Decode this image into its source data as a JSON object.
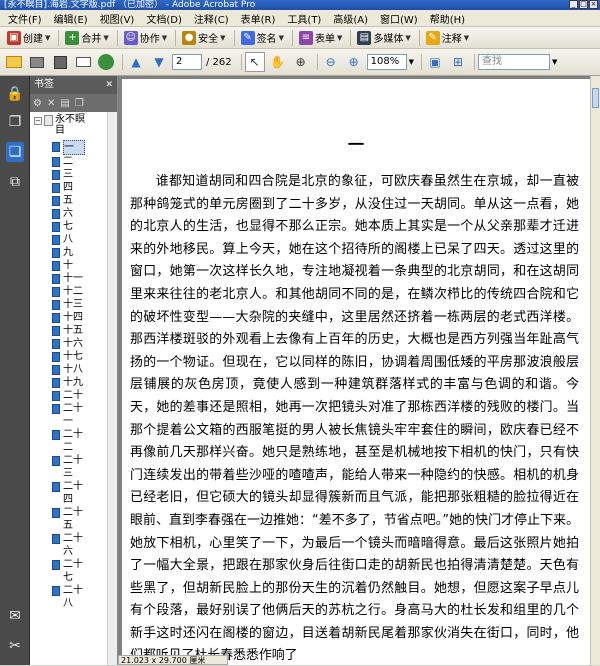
{
  "window": {
    "title": "[永不瞑目].海岩.文字版.pdf （已加密） - Adobe Acrobat Pro",
    "controls": [
      "_",
      "□",
      "×"
    ]
  },
  "menu": [
    "文件(F)",
    "编辑(E)",
    "视图(V)",
    "文档(D)",
    "注释(C)",
    "表单(R)",
    "工具(T)",
    "高级(A)",
    "窗口(W)",
    "帮助(H)"
  ],
  "toolbar1": {
    "create": "创建",
    "combine": "合并",
    "collaborate": "协作",
    "secure": "安全",
    "sign": "签名",
    "forms": "表单",
    "multimedia": "多媒体",
    "comment": "注释"
  },
  "toolbar2": {
    "current_page": "2",
    "page_count": "/ 262",
    "zoom": "108%",
    "find_placeholder": "查找"
  },
  "bookmarks": {
    "header": "书签",
    "root": "永不瞑目",
    "items": [
      "一",
      "二",
      "三",
      "四",
      "五",
      "六",
      "七",
      "八",
      "九",
      "十",
      "十一",
      "十二",
      "十三",
      "十四",
      "十五",
      "十六",
      "十七",
      "十八",
      "十九",
      "二十",
      "二十一",
      "二十二",
      "二十三",
      "二十四",
      "二十五",
      "二十六",
      "二十七",
      "二十八"
    ],
    "selected_index": 0
  },
  "document": {
    "chapter_title": "一",
    "body": "谁都知道胡同和四合院是北京的象征，可欧庆春虽然生在京城，却一直被那种鸽笼式的单元房圈到了二十多岁，从没住过一天胡同。单从这一点看，她的北京人的生活，也显得不那么正宗。她本质上其实是一个从父亲那辈才迁进来的外地移民。算上今天，她在这个招待所的阁楼上已呆了四天。透过这里的窗口，她第一次这样长久地，专注地凝视着一条典型的北京胡同，和在这胡同里来来往往的老北京人。和其他胡同不同的是，在鳞次栉比的传统四合院和它的破坏性变型——大杂院的夹缝中，这里居然还挤着一栋两层的老式西洋楼。那西洋楼斑驳的外观看上去像有上百年的历史，大概也是西方列强当年趾高气扬的一个物证。但现在，它以同样的陈旧，协调着周围低矮的平房那波浪般层层铺展的灰色房顶，竟使人感到一种建筑群落样式的丰富与色调的和谐。今天，她的差事还是照相，她再一次把镜头对准了那栋西洋楼的残败的楼门。当那个提着公文箱的西服笔挺的男人被长焦镜头牢牢套住的瞬间，欧庆春已经不再像前几天那样兴奋。她只是熟练地，甚至是机械地按下相机的快门，只有快门连续发出的带着些沙哑的喳喳声，能给人带来一种隐约的快感。相机的机身已经老旧，但它硕大的镜头却显得簇新而且气派，能把那张粗糙的脸拉得近在眼前、直到李春强在一边推她：“差不多了，节省点吧。”她的快门才停止下来。她放下相机，心里笑了一下，为最后一个镜头而暗暗得意。最后这张照片她拍了一幅大全景，把跟在那家伙身后往街口走的胡新民也拍得清清楚楚。天色有些黑了，但胡新民脸上的那份天生的沉着仍然触目。她想，但愿这案子早点儿有个段落，最好别误了他俩后天的苏杭之行。身高马大的杜长发和组里的几个新手这时还闪在阁楼的窗边，目送着胡新民尾着那家伙消失在街口，同时，他们都听见了杜长春悉悉作响了"
  },
  "status": {
    "page_size": "21.023 x 29.700 厘米"
  }
}
